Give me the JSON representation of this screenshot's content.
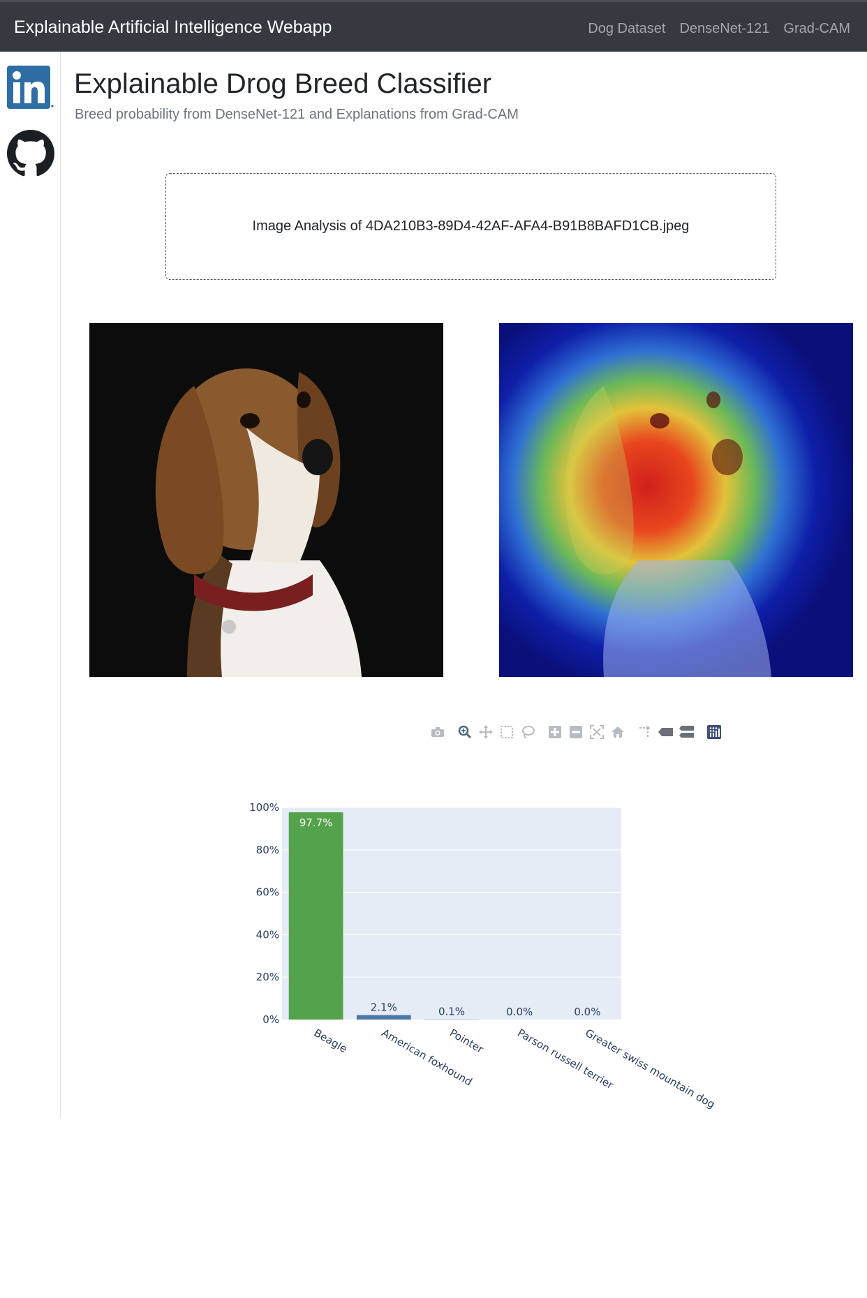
{
  "navbar": {
    "brand": "Explainable Artificial Intelligence Webapp",
    "links": [
      "Dog Dataset",
      "DenseNet-121",
      "Grad-CAM"
    ]
  },
  "sidebar": {
    "icons": [
      "linkedin-icon",
      "github-icon"
    ]
  },
  "header": {
    "title": "Explainable Drog Breed Classifier",
    "subtitle": "Breed probability from DenseNet-121 and Explanations from Grad-CAM"
  },
  "upload": {
    "text": "Image Analysis of 4DA210B3-89D4-42AF-AFA4-B91B8BAFD1CB.jpeg"
  },
  "modebar": {
    "buttons": [
      "camera-icon",
      "zoom-icon",
      "pan-icon",
      "box-select-icon",
      "lasso-select-icon",
      "zoom-in-icon",
      "zoom-out-icon",
      "autoscale-icon",
      "reset-axes-icon",
      "spike-lines-icon",
      "hover-closest-icon",
      "hover-compare-icon",
      "plotly-logo-icon"
    ]
  },
  "colors": {
    "navbar": "#343a40",
    "plot_bg": "#e5ecf6",
    "top_bar": "#54a24b",
    "other_bars": "#4c78a8"
  },
  "chart_data": {
    "type": "bar",
    "categories": [
      "Beagle",
      "American foxhound",
      "Pointer",
      "Parson russell terrier",
      "Greater swiss mountain dog"
    ],
    "values": [
      97.7,
      2.1,
      0.1,
      0.0,
      0.0
    ],
    "labels": [
      "97.7%",
      "2.1%",
      "0.1%",
      "0.0%",
      "0.0%"
    ],
    "y_ticks": [
      "0%",
      "20%",
      "40%",
      "60%",
      "80%",
      "100%"
    ],
    "ylim": [
      0,
      100
    ],
    "grid": true
  }
}
